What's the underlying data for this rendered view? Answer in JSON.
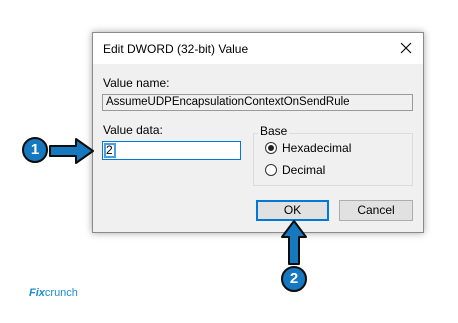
{
  "dialog": {
    "title": "Edit DWORD (32-bit) Value",
    "value_name_label": "Value name:",
    "value_name": "AssumeUDPEncapsulationContextOnSendRule",
    "value_data_label": "Value data:",
    "value_data": "2",
    "base": {
      "label": "Base",
      "options": [
        {
          "label": "Hexadecimal",
          "selected": true
        },
        {
          "label": "Decimal",
          "selected": false
        }
      ]
    },
    "ok_label": "OK",
    "cancel_label": "Cancel"
  },
  "callouts": [
    {
      "number": "1"
    },
    {
      "number": "2"
    }
  ],
  "logo": {
    "part1": "Fix",
    "part2": "crunch"
  },
  "colors": {
    "accent": "#0078d7",
    "callout_fill": "#1679bf",
    "dialog_bg": "#f0f0f0",
    "logo": "#1d8ccf"
  },
  "icons": [
    "close-icon",
    "right-arrow-icon",
    "up-arrow-icon"
  ]
}
